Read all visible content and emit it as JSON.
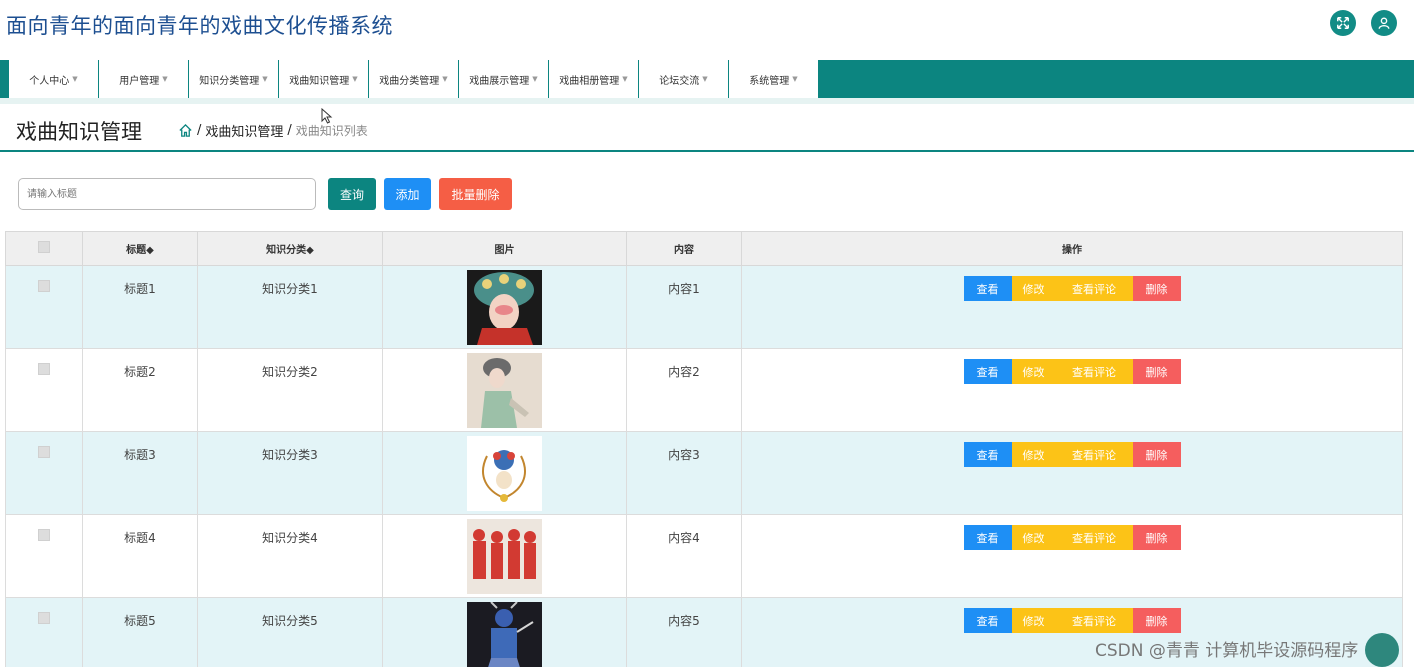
{
  "app": {
    "title": "面向青年的面向青年的戏曲文化传播系统"
  },
  "topbar": {
    "icons": [
      "expand-icon",
      "user-icon"
    ]
  },
  "nav": {
    "items": [
      {
        "label": "个人中心"
      },
      {
        "label": "用户管理"
      },
      {
        "label": "知识分类管理"
      },
      {
        "label": "戏曲知识管理"
      },
      {
        "label": "戏曲分类管理"
      },
      {
        "label": "戏曲展示管理"
      },
      {
        "label": "戏曲相册管理"
      },
      {
        "label": "论坛交流"
      },
      {
        "label": "系统管理"
      }
    ],
    "caret": "▼"
  },
  "page": {
    "title": "戏曲知识管理",
    "breadcrumb": {
      "sep": "/",
      "section": "戏曲知识管理",
      "current": "戏曲知识列表"
    }
  },
  "search": {
    "placeholder": "请输入标题"
  },
  "toolbar": {
    "query_label": "查询",
    "add_label": "添加",
    "batch_delete_label": "批量删除"
  },
  "table": {
    "headers": {
      "title": "标题◆",
      "category": "知识分类◆",
      "image": "图片",
      "content": "内容",
      "actions": "操作"
    },
    "rows": [
      {
        "title": "标题1",
        "category": "知识分类1",
        "content": "内容1"
      },
      {
        "title": "标题2",
        "category": "知识分类2",
        "content": "内容2"
      },
      {
        "title": "标题3",
        "category": "知识分类3",
        "content": "内容3"
      },
      {
        "title": "标题4",
        "category": "知识分类4",
        "content": "内容4"
      },
      {
        "title": "标题5",
        "category": "知识分类5",
        "content": "内容5"
      }
    ],
    "actions": {
      "view": "查看",
      "edit": "修改",
      "comments": "查看评论",
      "delete": "删除"
    }
  },
  "watermark": "CSDN @青青  计算机毕设源码程序",
  "colors": {
    "primary": "#0c8580",
    "blue": "#1e8ff5",
    "yellow": "#fcc317",
    "red": "#f55e5e",
    "row_highlight": "#e3f4f7"
  }
}
